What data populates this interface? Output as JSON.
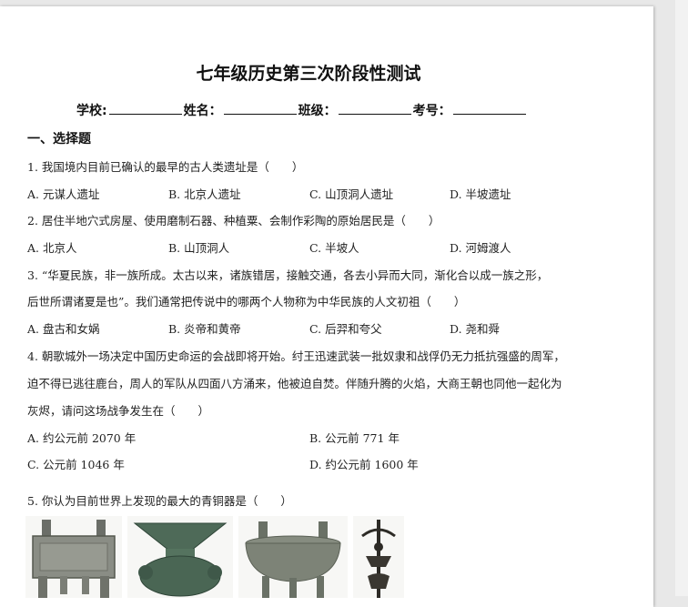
{
  "title": "七年级历史第三次阶段性测试",
  "info": {
    "school": "学校:",
    "name": "姓名：",
    "class": "班级：",
    "exam_no": "考号："
  },
  "section": "一、选择题",
  "q1": {
    "stem": "1. 我国境内目前已确认的最早的古人类遗址是（　　）",
    "a": "A. 元谋人遗址",
    "b": "B. 北京人遗址",
    "c": "C. 山顶洞人遗址",
    "d": "D. 半坡遗址"
  },
  "q2": {
    "stem": "2. 居住半地穴式房屋、使用磨制石器、种植粟、会制作彩陶的原始居民是（　　）",
    "a": "A. 北京人",
    "b": "B. 山顶洞人",
    "c": "C. 半坡人",
    "d": "D. 河姆渡人"
  },
  "q3": {
    "stem1": "3. “华夏民族，非一族所成。太古以来，诸族错居，接触交通，各去小异而大同，渐化合以成一族之形，",
    "stem2": "后世所谓诸夏是也”。我们通常把传说中的哪两个人物称为中华民族的人文初祖（　　）",
    "a": "A. 盘古和女娲",
    "b": "B. 炎帝和黄帝",
    "c": "C. 后羿和夸父",
    "d": "D. 尧和舜"
  },
  "q4": {
    "stem1": "4. 朝歌城外一场决定中国历史命运的会战即将开始。纣王迅速武装一批奴隶和战俘仍无力抵抗强盛的周军，",
    "stem2": "迫不得已逃往鹿台，周人的军队从四面八方涌来，他被迫自焚。伴随升腾的火焰，大商王朝也同他一起化为",
    "stem3": "灰烬，请问这场战争发生在（　　）",
    "a": "A. 约公元前 2070 年",
    "b": "B. 公元前 771 年",
    "c": "C. 公元前 1046 年",
    "d": "D. 约公元前 1600 年"
  },
  "q5": {
    "stem": "5. 你认为目前世界上发现的最大的青铜器是（　　）"
  }
}
